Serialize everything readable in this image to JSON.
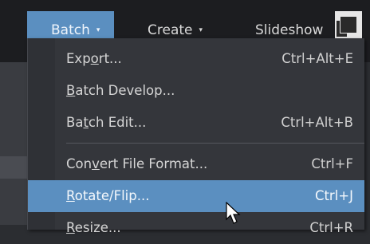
{
  "menubar": {
    "items": [
      {
        "label": "Batch",
        "caret": "▾"
      },
      {
        "label": "Create",
        "caret": "▾"
      },
      {
        "label": "Slideshow"
      }
    ]
  },
  "menu": {
    "items": [
      {
        "label": "Export...",
        "mnemonic_index": 3,
        "shortcut": "Ctrl+Alt+E"
      },
      {
        "label": "Batch Develop...",
        "mnemonic_index": 0,
        "shortcut": ""
      },
      {
        "label": "Batch Edit...",
        "mnemonic_index": 2,
        "shortcut": "Ctrl+Alt+B"
      },
      {
        "label": "Convert File Format...",
        "mnemonic_index": 3,
        "shortcut": "Ctrl+F"
      },
      {
        "label": "Rotate/Flip...",
        "mnemonic_index": 0,
        "shortcut": "Ctrl+J",
        "highlighted": true
      },
      {
        "label": "Resize...",
        "mnemonic_index": 0,
        "shortcut": "Ctrl+R"
      }
    ]
  },
  "colors": {
    "accent": "#5b8fc0",
    "menu_bg": "#34363b",
    "menubar_bg": "#1c1d20"
  },
  "icons": {
    "corner": "restore-window-icon",
    "pointer": "mouse-cursor-icon"
  }
}
